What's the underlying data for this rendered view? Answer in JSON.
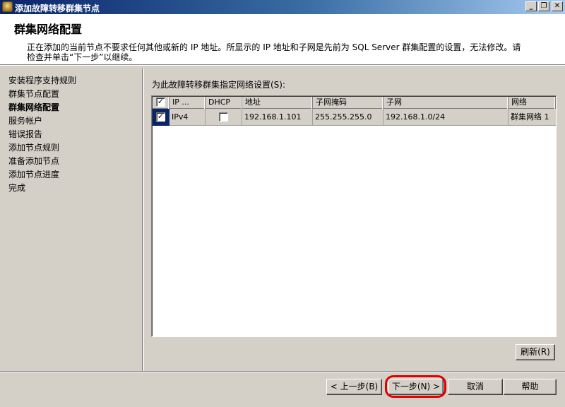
{
  "window": {
    "title": "添加故障转移群集节点",
    "minimize": "_",
    "restore": "❐",
    "close": "✕"
  },
  "header": {
    "heading": "群集网络配置",
    "description": "正在添加的当前节点不要求任何其他或新的 IP 地址。所显示的 IP 地址和子网是先前为 SQL Server 群集配置的设置，无法修改。请检查并单击“下一步”以继续。"
  },
  "nav": {
    "items": [
      {
        "label": "安装程序支持规则"
      },
      {
        "label": "群集节点配置"
      },
      {
        "label": "群集网络配置"
      },
      {
        "label": "服务帐户"
      },
      {
        "label": "错误报告"
      },
      {
        "label": "添加节点规则"
      },
      {
        "label": "准备添加节点"
      },
      {
        "label": "添加节点进度"
      },
      {
        "label": "完成"
      }
    ],
    "current": "群集网络配置"
  },
  "content": {
    "label": "为此故障转移群集指定网络设置(S):"
  },
  "grid": {
    "headers": [
      "",
      "IP ...",
      "DHCP",
      "地址",
      "子网掩码",
      "子网",
      "网络"
    ],
    "header_checked": "✓",
    "rows": [
      {
        "checked": "✓",
        "ip_type": "IPv4",
        "dhcp": "",
        "address": "192.168.1.101",
        "subnet_mask": "255.255.255.0",
        "subnet": "192.168.1.0/24",
        "network": "群集网络 1"
      }
    ]
  },
  "buttons": {
    "refresh": "刷新(R)",
    "back": "< 上一步(B)",
    "next": "下一步(N) >",
    "cancel": "取消",
    "help": "帮助"
  },
  "colors": {
    "highlight_ring": "#e00000",
    "selection": "#0a246a"
  }
}
